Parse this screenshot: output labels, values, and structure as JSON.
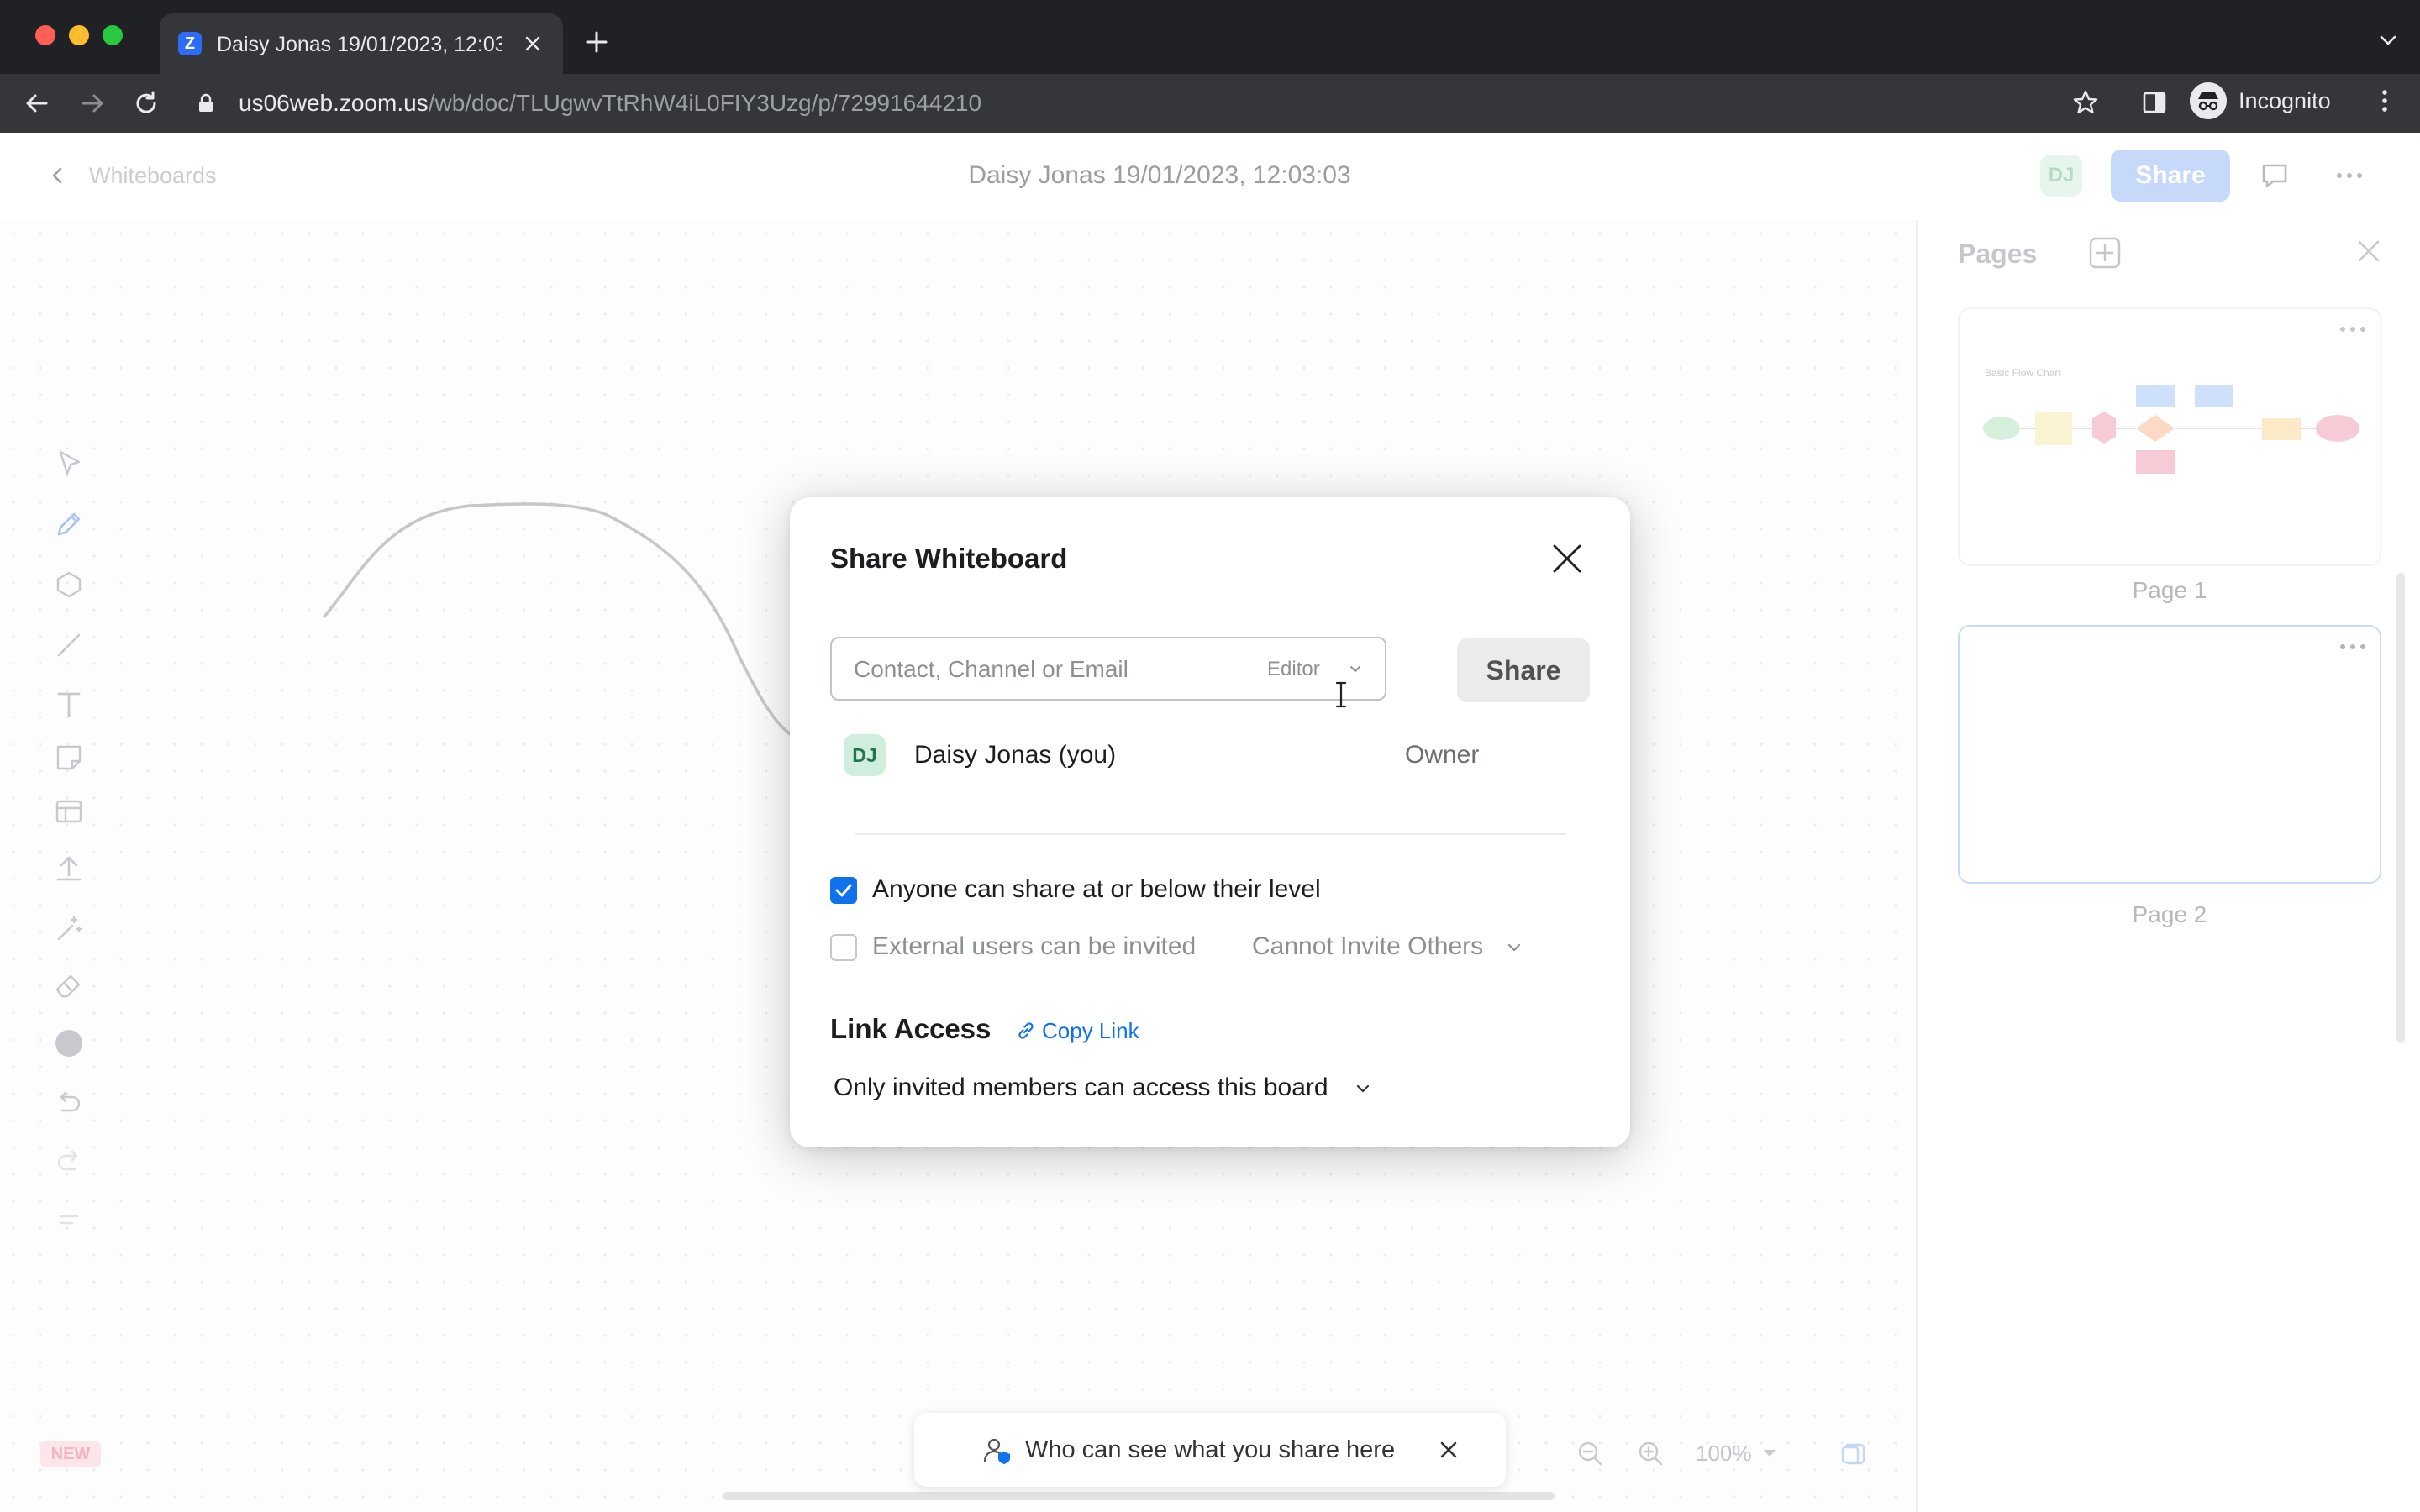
{
  "browser": {
    "tab_title": "Daisy Jonas 19/01/2023, 12:03",
    "favicon_letter": "Z",
    "url_host": "us06web.zoom.us",
    "url_path": "/wb/doc/TLUgwvTtRhW4iL0FIY3Uzg/p/72991644210",
    "profile_label": "Incognito"
  },
  "app_header": {
    "back_label": "Whiteboards",
    "doc_title": "Daisy Jonas 19/01/2023, 12:03:03",
    "avatar_initials": "DJ",
    "share_label": "Share"
  },
  "left_toolbar": {
    "tools": [
      "select-icon",
      "pen-icon",
      "shape-icon",
      "line-icon",
      "text-icon",
      "sticky-note-icon",
      "template-icon",
      "upload-icon",
      "magic-icon",
      "eraser-icon",
      "color-icon",
      "undo-icon",
      "redo-icon",
      "more-tools-icon"
    ]
  },
  "canvas": {
    "new_badge": "NEW",
    "zoom_level": "100%"
  },
  "toast": {
    "text": "Who can see what you share here"
  },
  "pages_panel": {
    "title": "Pages",
    "pages": [
      {
        "label": "Page 1",
        "thumb_title": "Basic Flow Chart"
      },
      {
        "label": "Page 2"
      }
    ]
  },
  "share_modal": {
    "title": "Share Whiteboard",
    "input_placeholder": "Contact, Channel or Email",
    "role_selected": "Editor",
    "share_button": "Share",
    "members": [
      {
        "initials": "DJ",
        "name": "Daisy Jonas (you)",
        "role": "Owner"
      }
    ],
    "option_share_level": {
      "label": "Anyone can share at or below their level",
      "checked": true
    },
    "option_external": {
      "label": "External users can be invited",
      "checked": false
    },
    "external_select": "Cannot Invite Others",
    "link_access_title": "Link Access",
    "copy_link_label": "Copy Link",
    "access_select": "Only invited members can access this board"
  },
  "colors": {
    "accent": "#0e72ed",
    "browser_dark": "#202124",
    "browser_toolbar": "#35363a"
  }
}
